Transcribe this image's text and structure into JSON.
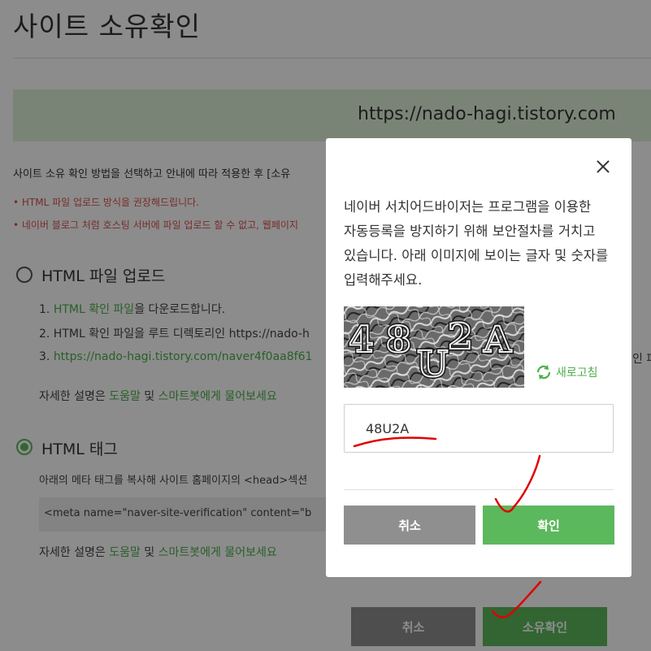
{
  "page": {
    "title": "사이트 소유확인",
    "site_url": "https://nado-hagi.tistory.com",
    "intro": "사이트 소유 확인 방법을 선택하고 안내에 따라 적용한 후 [소유",
    "warnings": [
      "• HTML 파일 업로드 방식을 권장해드립니다.",
      "• 네이버 블로그 처럼 호스팅 서버에 파일 업로드 할 수 없고, 웹페이지"
    ],
    "option_html_file": {
      "label": "HTML 파일 업로드",
      "step1_link": "HTML 확인 파일",
      "step1_rest": "을 다운로드합니다.",
      "step2": "2. HTML 확인 파일을 루트 디렉토리인 https://nado-h",
      "step3_prefix": "3. ",
      "step3_link": "https://nado-hagi.tistory.com/naver4f0aa8f61",
      "step3_tail": "인 파",
      "help_prefix": "자세한 설명은 ",
      "help_link1": "도움말",
      "help_mid": " 및 ",
      "help_link2": "스마트봇에게 물어보세요"
    },
    "option_html_tag": {
      "label": "HTML 태그",
      "description": "아래의 메타 태그를 복사해 사이트 홈페이지의 <head>섹션",
      "meta_code": "<meta name=\"naver-site-verification\" content=\"b",
      "help_prefix": "자세한 설명은 ",
      "help_link1": "도움말",
      "help_mid": " 및 ",
      "help_link2": "스마트봇에게 물어보세요"
    },
    "cancel_label": "취소",
    "confirm_label": "소유확인"
  },
  "modal": {
    "message": "네이버 서치어드바이저는 프로그램을 이용한 자동등록을 방지하기 위해 보안절차를 거치고 있습니다. 아래 이미지에 보이는 글자 및 숫자를 입력해주세요.",
    "captcha_text": "48U2A",
    "refresh_label": "새로고침",
    "input_value": "48U2A",
    "cancel_label": "취소",
    "confirm_label": "확인"
  },
  "colors": {
    "accent_green": "#5cb85c",
    "link_green": "#4cae4c",
    "warning_red": "#d9534f",
    "banner_bg": "#dff0d8",
    "gray_button": "#8f8f8f",
    "annotation_red": "#e00000"
  }
}
